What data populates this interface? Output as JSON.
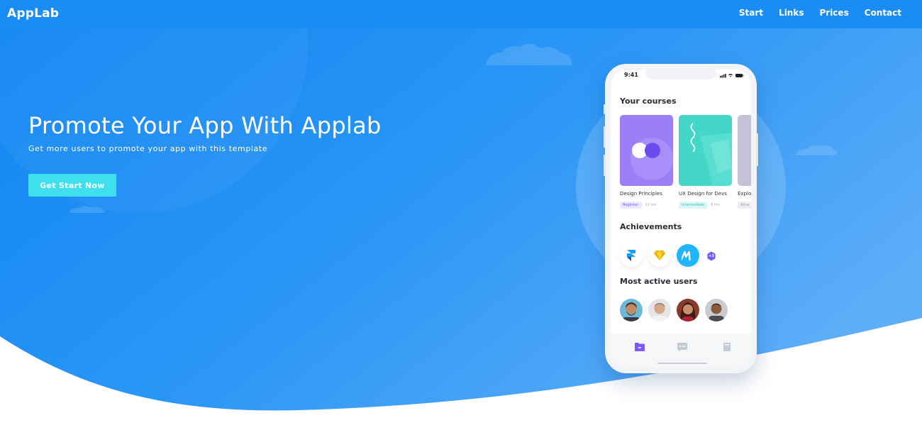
{
  "brand": {
    "logo": "AppLab"
  },
  "nav": {
    "items": [
      {
        "label": "Start"
      },
      {
        "label": "Links"
      },
      {
        "label": "Prices"
      },
      {
        "label": "Contact"
      }
    ]
  },
  "hero": {
    "title": "Promote Your App With Applab",
    "subtitle": "Get more users to promote your app with this template",
    "cta_label": "Get Start Now"
  },
  "phone": {
    "status_time": "9:41",
    "courses_title": "Your courses",
    "courses": [
      {
        "name": "Design Principles",
        "level": "Beginner",
        "hours": "12 hrs"
      },
      {
        "name": "UX Design for Devs",
        "level": "Intermediate",
        "hours": "8 hrs"
      },
      {
        "name": "Explo",
        "level": "Adva",
        "hours": ""
      }
    ],
    "achievements_title": "Achievements",
    "achievements": [
      {
        "icon": "framer-icon"
      },
      {
        "icon": "sketch-icon"
      },
      {
        "icon": "marvel-icon"
      }
    ],
    "achievements_more": "+3",
    "users_title": "Most active users",
    "tabs": [
      {
        "icon": "folder-icon"
      },
      {
        "icon": "chat-icon"
      },
      {
        "icon": "book-icon"
      }
    ]
  },
  "colors": {
    "navbar": "#1a8cf5",
    "hero_start": "#1389f4",
    "hero_end": "#57aaf7",
    "cta": "#3ee0ee",
    "accent_purple": "#7a5af8"
  }
}
